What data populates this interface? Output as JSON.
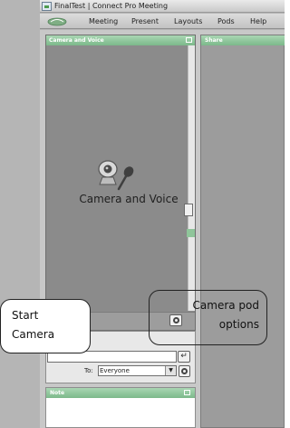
{
  "window": {
    "title": "FinalTest | Connect Pro Meeting"
  },
  "menu": {
    "items": [
      "Meeting",
      "Present",
      "Layouts",
      "Pods",
      "Help"
    ]
  },
  "pods": {
    "camera_voice": {
      "title": "Camera and Voice",
      "placeholder_label": "Camera and Voice"
    },
    "share": {
      "title": "Share"
    },
    "note": {
      "title": "Note"
    },
    "chat": {
      "to_label": "To:",
      "recipient": "Everyone",
      "input_value": ""
    }
  },
  "callouts": {
    "start_camera": "Start\nCamera",
    "camera_pod_options": "Camera pod\noptions"
  },
  "colors": {
    "pod_header": "#8fc59a",
    "pod_body": "#8b8b8b",
    "stage": "#c8c8c8"
  },
  "icons": [
    "app-icon",
    "connect-logo-icon",
    "webcam-microphone-icon",
    "pod-menu-icon",
    "start-camera-icon",
    "microphone-icon",
    "pod-options-icon",
    "send-icon",
    "dropdown-arrow-icon",
    "chat-options-icon"
  ]
}
